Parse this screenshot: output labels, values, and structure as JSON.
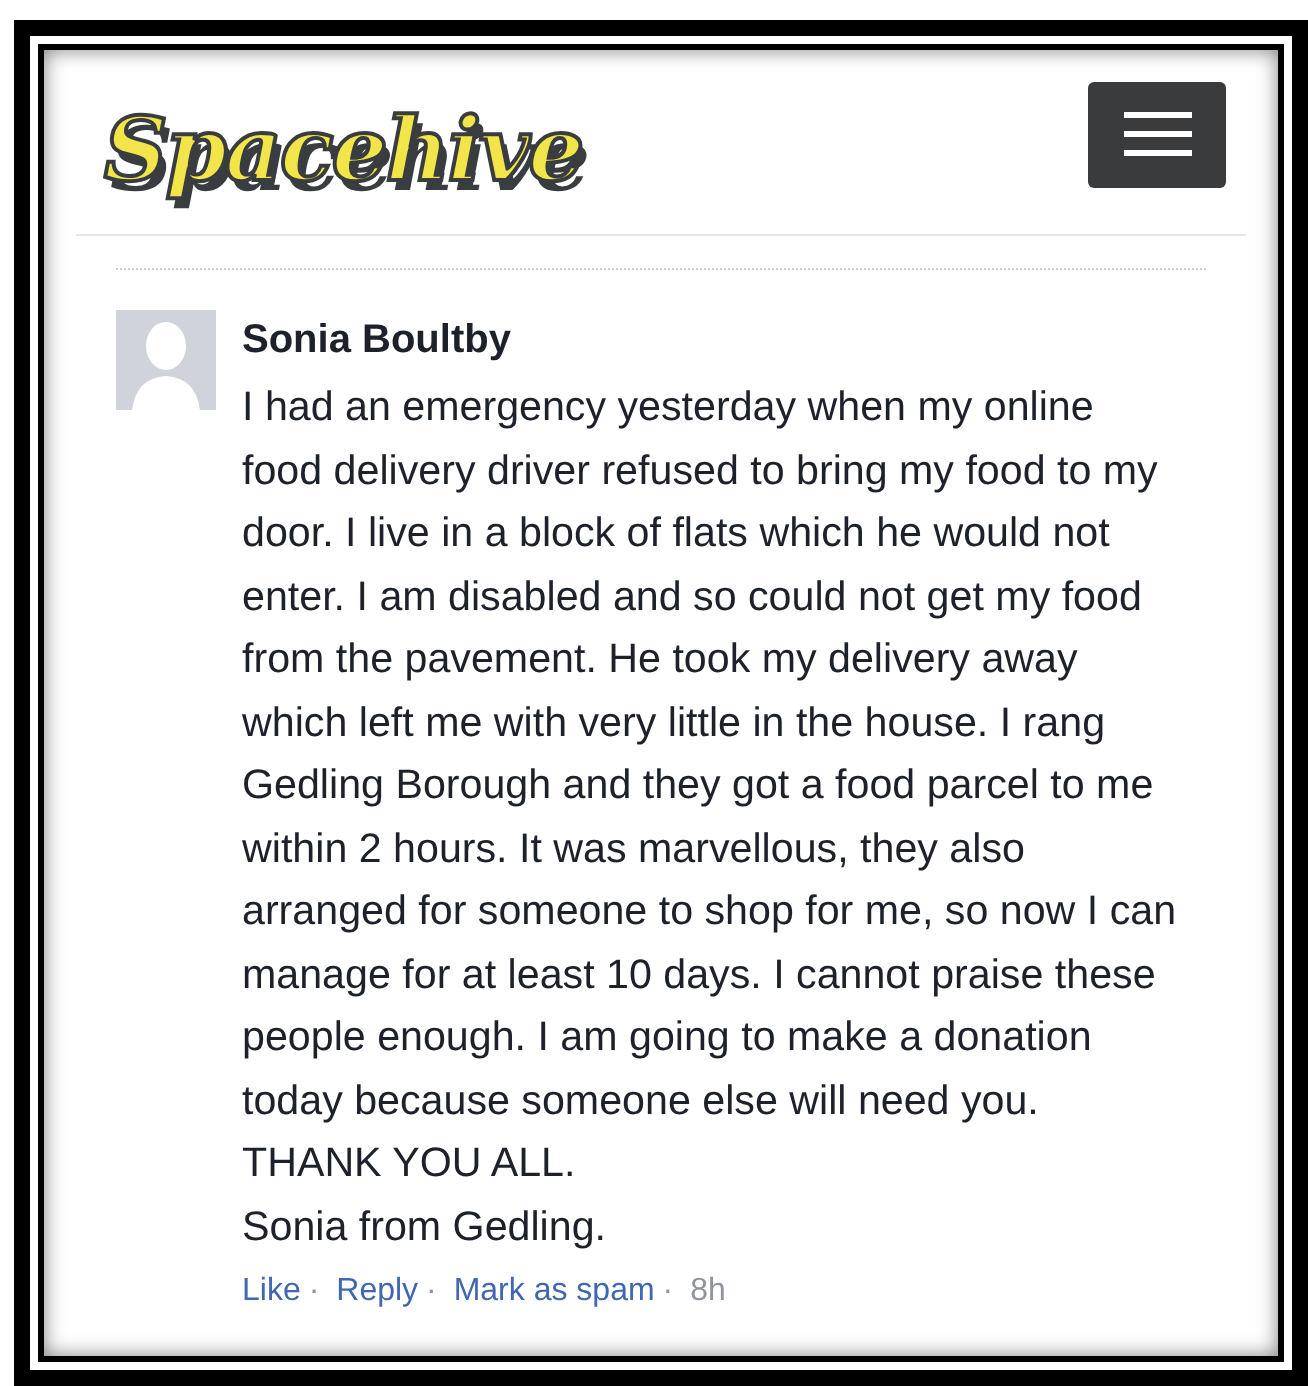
{
  "header": {
    "logo": "Spacehive"
  },
  "comment": {
    "author": "Sonia Boultby",
    "body": "I had an emergency yesterday when my online food delivery driver refused to bring my food to my door. I live in a block of flats which he would not enter. I am disabled and so could not get my food from the pavement. He took my delivery away which left me with very little in the house. I rang Gedling Borough and they got a food parcel to me within 2 hours. It was marvellous, they also arranged for someone to shop for me, so now I can manage for at least 10 days. I cannot praise these people enough. I am going to make a donation today because someone else will need you. THANK YOU ALL.",
    "signoff": "Sonia from Gedling.",
    "separator": "·",
    "actions": [
      {
        "label": "Like",
        "kind": "link"
      },
      {
        "label": "Reply",
        "kind": "link"
      },
      {
        "label": "Mark as spam",
        "kind": "link"
      },
      {
        "label": "8h",
        "kind": "time"
      }
    ]
  }
}
